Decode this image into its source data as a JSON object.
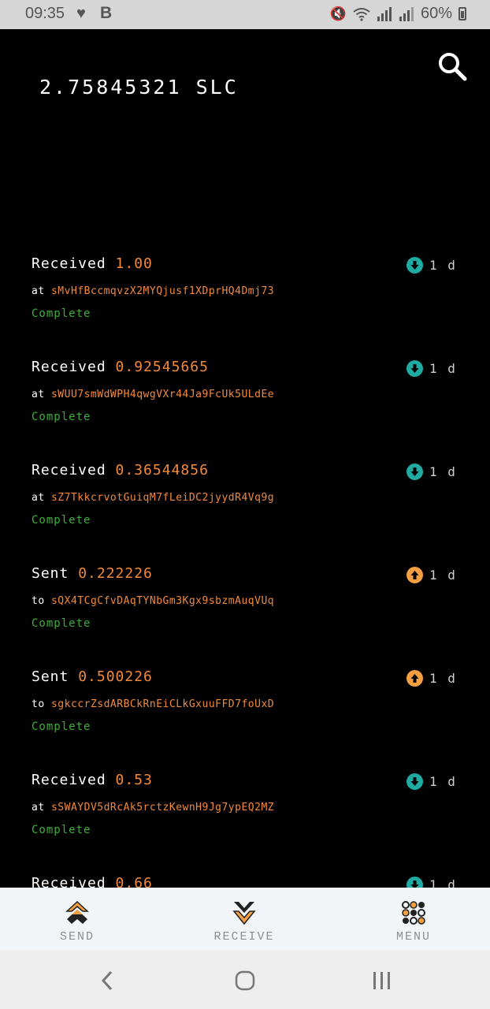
{
  "status_bar": {
    "time": "09:35",
    "heart_icon": "heart-icon",
    "b_label": "B",
    "battery": "60%"
  },
  "header": {
    "balance": "2.75845321 SLC"
  },
  "transactions": [
    {
      "kind": "Received",
      "amount": "1.00",
      "prep": "at",
      "address": "sMvHfBccmqvzX2MYQjusf1XDprHQ4Dmj73",
      "status": "Complete",
      "age": "1 d",
      "direction": "in"
    },
    {
      "kind": "Received",
      "amount": "0.92545665",
      "prep": "at",
      "address": "sWUU7smWdWPH4qwgVXr44Ja9FcUk5ULdEe",
      "status": "Complete",
      "age": "1 d",
      "direction": "in"
    },
    {
      "kind": "Received",
      "amount": "0.36544856",
      "prep": "at",
      "address": "sZ7TkkcrvotGuiqM7fLeiDC2jyydR4Vq9g",
      "status": "Complete",
      "age": "1 d",
      "direction": "in"
    },
    {
      "kind": "Sent",
      "amount": "0.222226",
      "prep": "to",
      "address": "sQX4TCgCfvDAqTYNbGm3Kgx9sbzmAuqVUq",
      "status": "Complete",
      "age": "1 d",
      "direction": "out"
    },
    {
      "kind": "Sent",
      "amount": "0.500226",
      "prep": "to",
      "address": "sgkccrZsdARBCkRnEiCLkGxuuFFD7foUxD",
      "status": "Complete",
      "age": "1 d",
      "direction": "out"
    },
    {
      "kind": "Received",
      "amount": "0.53",
      "prep": "at",
      "address": "sSWAYDV5dRcAk5rctzKewnH9Jg7ypEQ2MZ",
      "status": "Complete",
      "age": "1 d",
      "direction": "in"
    },
    {
      "kind": "Received",
      "amount": "0.66",
      "prep": "",
      "address": "",
      "status": "",
      "age": "1 d",
      "direction": "in"
    }
  ],
  "bottom_nav": {
    "send": "SEND",
    "receive": "RECEIVE",
    "menu": "MENU"
  },
  "colors": {
    "amount": "#f28a3a",
    "complete": "#3fae3a",
    "received": "#1faaa2",
    "sent": "#f5a040"
  }
}
